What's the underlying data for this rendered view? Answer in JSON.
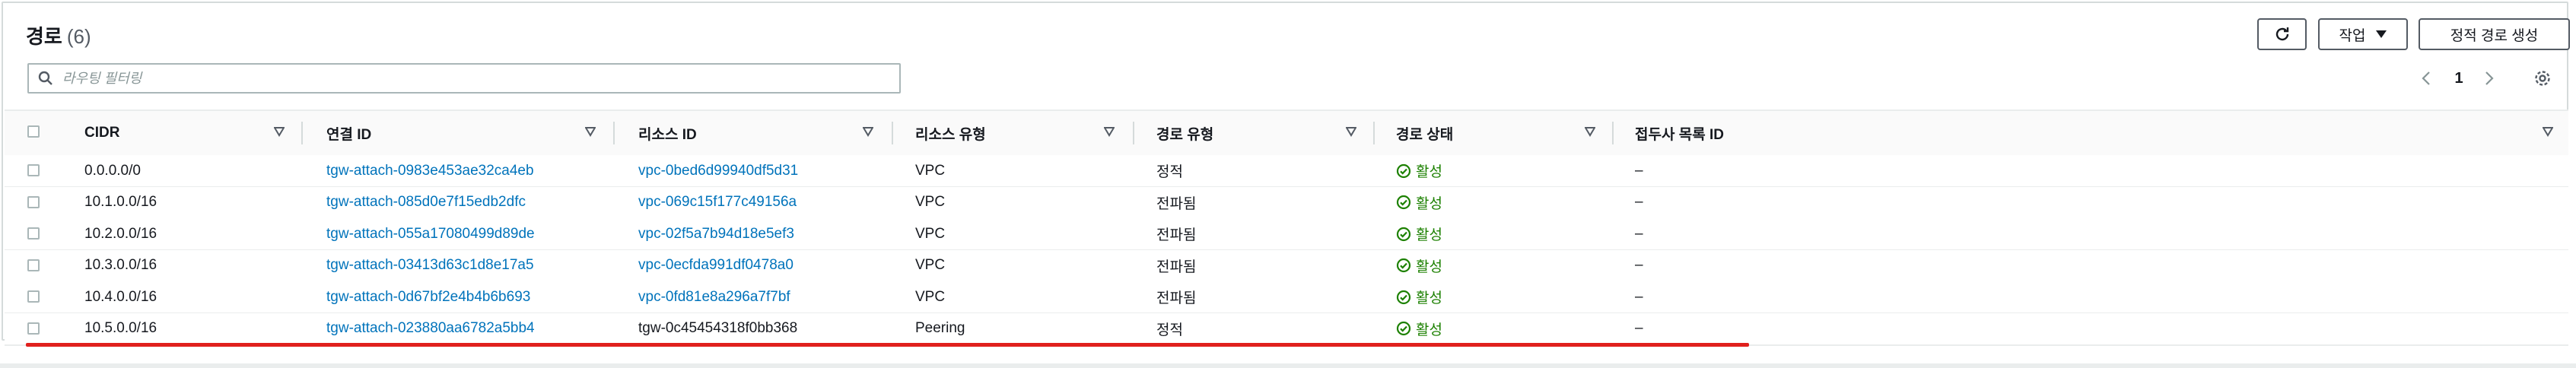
{
  "header": {
    "title": "경로",
    "count": "(6)",
    "actions_label": "작업",
    "create_label": "정적 경로 생성"
  },
  "search": {
    "placeholder": "라우팅 필터링"
  },
  "pagination": {
    "current_page": "1"
  },
  "columns": {
    "cidr": "CIDR",
    "attachment_id": "연결 ID",
    "resource_id": "리소스 ID",
    "resource_type": "리소스 유형",
    "route_type": "경로 유형",
    "route_state": "경로 상태",
    "prefix_list_id": "접두사 목록 ID"
  },
  "rows": [
    {
      "cidr": "0.0.0.0/0",
      "attachment_id": "tgw-attach-0983e453ae32ca4eb",
      "resource_id": "vpc-0bed6d99940df5d31",
      "resource_link": true,
      "resource_type": "VPC",
      "route_type": "정적",
      "route_state": "활성",
      "prefix_list_id": "–"
    },
    {
      "cidr": "10.1.0.0/16",
      "attachment_id": "tgw-attach-085d0e7f15edb2dfc",
      "resource_id": "vpc-069c15f177c49156a",
      "resource_link": true,
      "resource_type": "VPC",
      "route_type": "전파됨",
      "route_state": "활성",
      "prefix_list_id": "–"
    },
    {
      "cidr": "10.2.0.0/16",
      "attachment_id": "tgw-attach-055a17080499d89de",
      "resource_id": "vpc-02f5a7b94d18e5ef3",
      "resource_link": true,
      "resource_type": "VPC",
      "route_type": "전파됨",
      "route_state": "활성",
      "prefix_list_id": "–"
    },
    {
      "cidr": "10.3.0.0/16",
      "attachment_id": "tgw-attach-03413d63c1d8e17a5",
      "resource_id": "vpc-0ecfda991df0478a0",
      "resource_link": true,
      "resource_type": "VPC",
      "route_type": "전파됨",
      "route_state": "활성",
      "prefix_list_id": "–"
    },
    {
      "cidr": "10.4.0.0/16",
      "attachment_id": "tgw-attach-0d67bf2e4b4b6b693",
      "resource_id": "vpc-0fd81e8a296a7f7bf",
      "resource_link": true,
      "resource_type": "VPC",
      "route_type": "전파됨",
      "route_state": "활성",
      "prefix_list_id": "–"
    },
    {
      "cidr": "10.5.0.0/16",
      "attachment_id": "tgw-attach-023880aa6782a5bb4",
      "resource_id": "tgw-0c45454318f0bb368",
      "resource_link": false,
      "resource_type": "Peering",
      "route_type": "정적",
      "route_state": "활성",
      "prefix_list_id": "–"
    }
  ],
  "colors": {
    "link": "#0073bb",
    "success": "#1d8102",
    "annotation": "#e0201d"
  },
  "icons": [
    "refresh-icon",
    "caret-down-icon",
    "search-icon",
    "chevron-left-icon",
    "chevron-right-icon",
    "gear-icon",
    "sort-icon",
    "status-success-icon"
  ]
}
